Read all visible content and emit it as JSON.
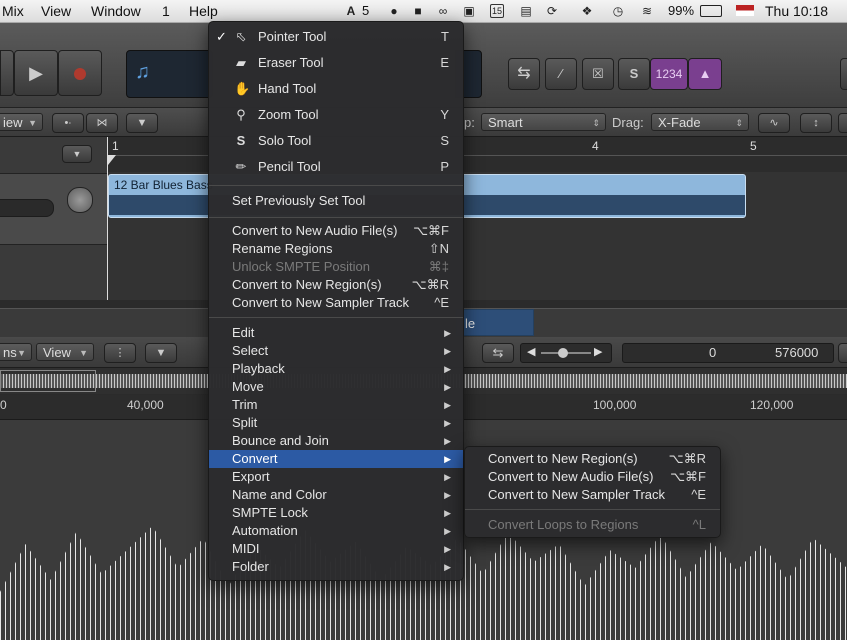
{
  "menubar": {
    "items": [
      "Mix",
      "View",
      "Window",
      "1",
      "Help"
    ],
    "status": {
      "adobe_badge": "5",
      "battery": "99%",
      "clock": "Thu 10:18",
      "calendar_day": "15"
    }
  },
  "controlbar": {
    "lcd_numbers": "1234"
  },
  "tracktoolbar": {
    "view_label": "iew",
    "snap_label": "p:",
    "snap_value": "Smart",
    "drag_label": "Drag:",
    "drag_value": "X-Fade"
  },
  "ruler": {
    "marks": [
      "1",
      "4",
      "5"
    ]
  },
  "region": {
    "name": "12 Bar Blues Bass"
  },
  "editor": {
    "tab_label": "le",
    "view_left": "ns",
    "view_label": "View",
    "position_start": "0",
    "position_end": "576000",
    "sample_ticks": [
      "0",
      "40,000",
      "100,000",
      "120,000"
    ]
  },
  "main_menu": {
    "tools": [
      {
        "label": "Pointer Tool",
        "shortcut": "T",
        "icon": "pointer-icon",
        "checked": true
      },
      {
        "label": "Eraser Tool",
        "shortcut": "E",
        "icon": "eraser-icon"
      },
      {
        "label": "Hand Tool",
        "shortcut": "",
        "icon": "hand-icon"
      },
      {
        "label": "Zoom Tool",
        "shortcut": "Y",
        "icon": "zoom-icon"
      },
      {
        "label": "Solo Tool",
        "shortcut": "S",
        "icon": "solo-icon"
      },
      {
        "label": "Pencil Tool",
        "shortcut": "P",
        "icon": "pencil-icon"
      }
    ],
    "set_previous": "Set Previously Set Tool",
    "actions": [
      {
        "label": "Convert to New Audio File(s)",
        "shortcut": "⌥⌘F",
        "disabled": false
      },
      {
        "label": "Rename Regions",
        "shortcut": "⇧N",
        "disabled": false
      },
      {
        "label": "Unlock SMPTE Position",
        "shortcut": "⌘‡",
        "disabled": true
      },
      {
        "label": "Convert to New Region(s)",
        "shortcut": "⌥⌘R",
        "disabled": false
      },
      {
        "label": "Convert to New Sampler Track",
        "shortcut": "^E",
        "disabled": false
      }
    ],
    "submenus": [
      "Edit",
      "Select",
      "Playback",
      "Move",
      "Trim",
      "Split",
      "Bounce and Join",
      "Convert",
      "Export",
      "Name and Color",
      "SMPTE Lock",
      "Automation",
      "MIDI",
      "Folder"
    ],
    "highlighted": "Convert"
  },
  "convert_submenu": {
    "items": [
      {
        "label": "Convert to New Region(s)",
        "shortcut": "⌥⌘R",
        "disabled": false
      },
      {
        "label": "Convert to New Audio File(s)",
        "shortcut": "⌥⌘F",
        "disabled": false
      },
      {
        "label": "Convert to New Sampler Track",
        "shortcut": "^E",
        "disabled": false
      },
      {
        "label": "Convert Loops to Regions",
        "shortcut": "^L",
        "disabled": true
      }
    ]
  },
  "colors": {
    "highlight": "#2c5aa4",
    "region": "#8eb7dc",
    "accent_purple": "#7a3f8f"
  }
}
